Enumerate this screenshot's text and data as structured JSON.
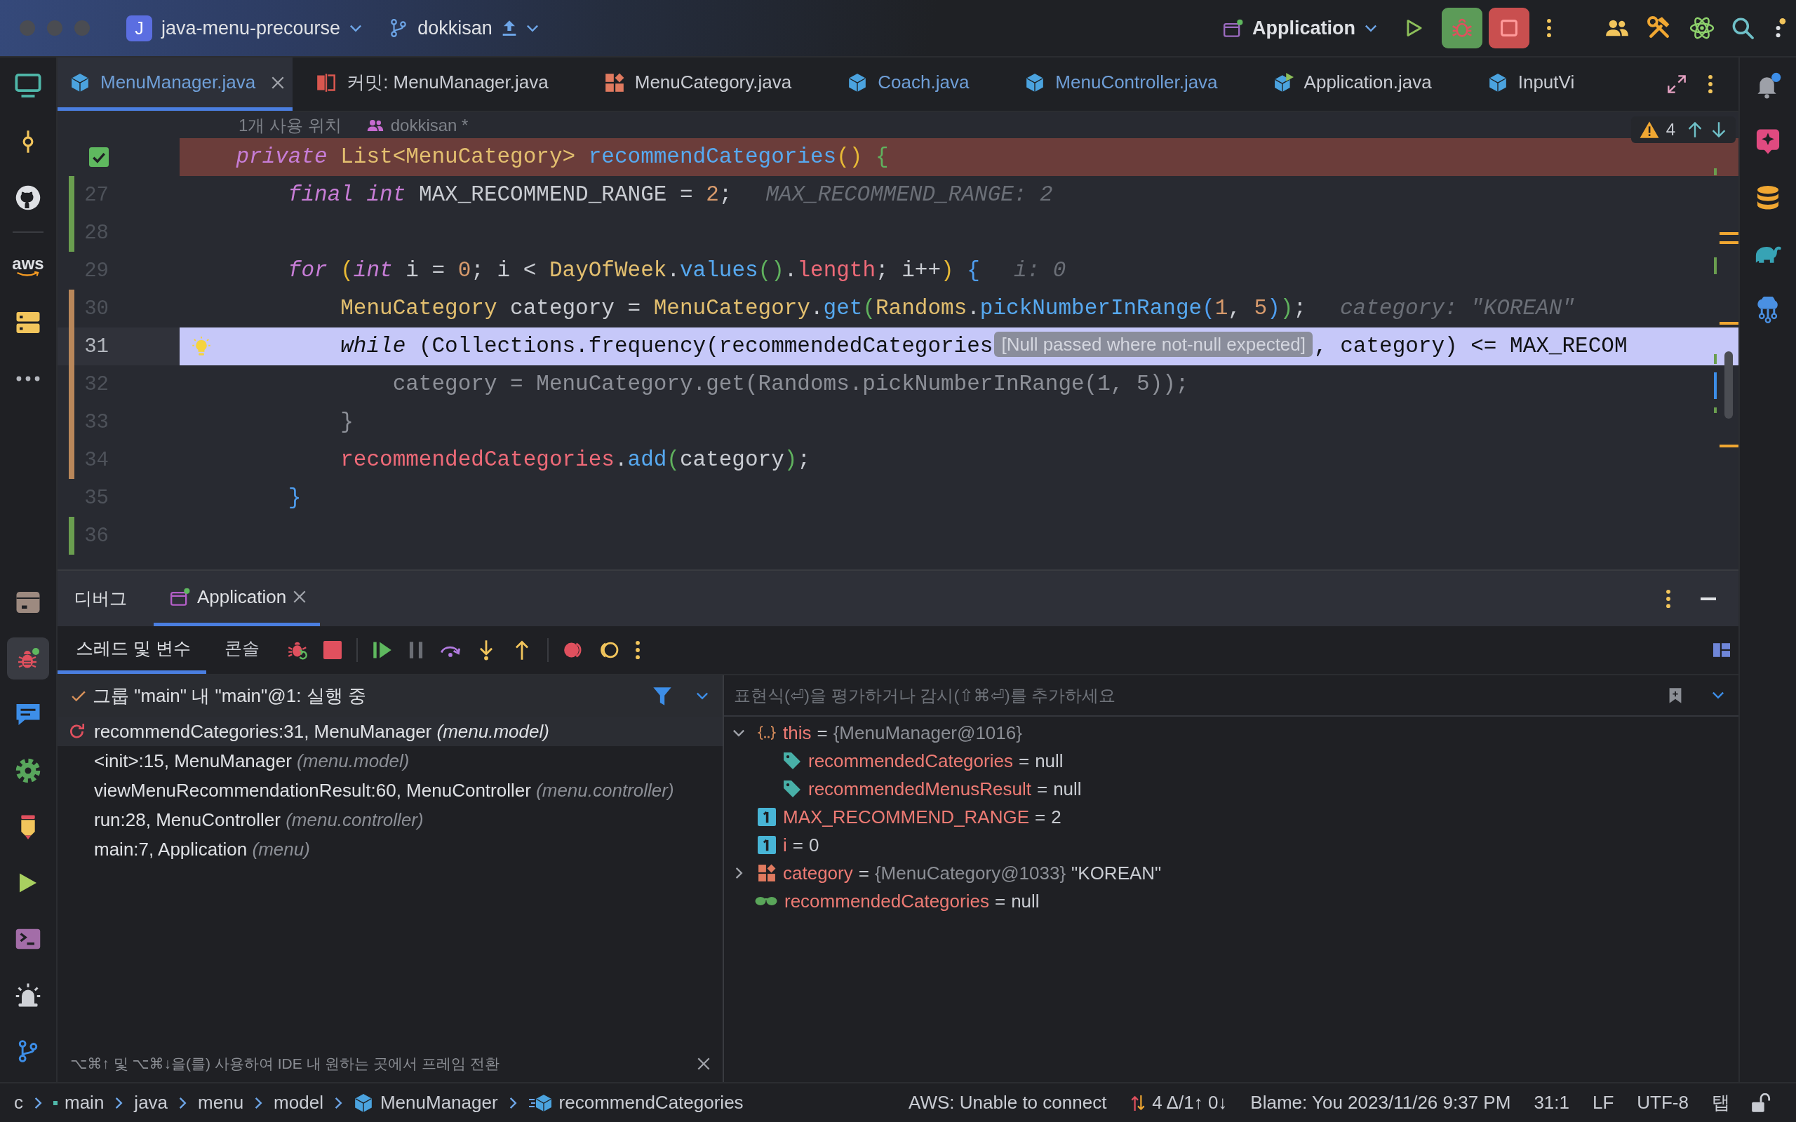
{
  "title_bar": {
    "project": {
      "badge": "J",
      "name": "java-menu-precourse"
    },
    "branch": "dokkisan",
    "run_config": "Application"
  },
  "left_toolbar": {
    "logo_text": "aws"
  },
  "editor_tabs": [
    {
      "label": "MenuManager.java",
      "kind": "class",
      "selected": true,
      "modified": true
    },
    {
      "label": "커밋: MenuManager.java",
      "kind": "diff",
      "selected": false,
      "modified": false
    },
    {
      "label": "MenuCategory.java",
      "kind": "enum",
      "selected": false,
      "modified": false
    },
    {
      "label": "Coach.java",
      "kind": "class",
      "selected": false,
      "modified": true
    },
    {
      "label": "MenuController.java",
      "kind": "class",
      "selected": false,
      "modified": true
    },
    {
      "label": "Application.java",
      "kind": "main_class",
      "selected": false,
      "modified": false
    },
    {
      "label": "InputVi",
      "kind": "class",
      "selected": false,
      "modified": false
    }
  ],
  "editor": {
    "usage_hint": "1개 사용 위치",
    "author_hint": "dokkisan *",
    "warning_count": "4",
    "lines": [
      {
        "breakpoint": true,
        "current": false,
        "added": false,
        "modified": false,
        "segments": [
          {
            "kind": "code",
            "tokens": [
              {
                "text": "    private ",
                "kind": "keyword"
              },
              {
                "text": "List<MenuCategory> ",
                "kind": "type"
              },
              {
                "text": "recommendCategories",
                "kind": "method"
              },
              {
                "text": "() ",
                "kind": "bracket1"
              },
              {
                "text": "{",
                "kind": "bracket2"
              }
            ]
          }
        ]
      },
      {
        "number": "27",
        "breakpoint": false,
        "current": false,
        "added": true,
        "modified": false,
        "segments": [
          {
            "kind": "code",
            "tokens": [
              {
                "text": "        final ",
                "kind": "keyword"
              },
              {
                "text": "int ",
                "kind": "keyword"
              },
              {
                "text": "MAX_RECOMMEND_RANGE = ",
                "kind": "plain"
              },
              {
                "text": "2",
                "kind": "number"
              },
              {
                "text": ";",
                "kind": "plain"
              }
            ]
          },
          {
            "kind": "value",
            "text": "MAX_RECOMMEND_RANGE: 2"
          }
        ]
      },
      {
        "number": "28",
        "breakpoint": false,
        "current": false,
        "added": true,
        "modified": false
      },
      {
        "number": "29",
        "breakpoint": false,
        "current": false,
        "added": false,
        "modified": false,
        "segments": [
          {
            "kind": "code",
            "tokens": [
              {
                "text": "        for ",
                "kind": "keyword"
              },
              {
                "text": "(",
                "kind": "bracket1"
              },
              {
                "text": "int ",
                "kind": "keyword"
              },
              {
                "text": "i = ",
                "kind": "plain"
              },
              {
                "text": "0",
                "kind": "number"
              },
              {
                "text": "; i < ",
                "kind": "plain"
              },
              {
                "text": "DayOfWeek",
                "kind": "type"
              },
              {
                "text": ".",
                "kind": "plain"
              },
              {
                "text": "values",
                "kind": "method"
              },
              {
                "text": "()",
                "kind": "bracket2"
              },
              {
                "text": ".",
                "kind": "plain"
              },
              {
                "text": "length",
                "kind": "field"
              },
              {
                "text": "; i++",
                "kind": "plain"
              },
              {
                "text": ") ",
                "kind": "bracket1"
              },
              {
                "text": "{",
                "kind": "bracket3"
              }
            ]
          },
          {
            "kind": "value",
            "text": "i: 0"
          }
        ]
      },
      {
        "number": "30",
        "breakpoint": false,
        "current": false,
        "added": false,
        "modified": true,
        "segments": [
          {
            "kind": "code",
            "tokens": [
              {
                "text": "            MenuCategory ",
                "kind": "type"
              },
              {
                "text": "category = ",
                "kind": "plain"
              },
              {
                "text": "MenuCategory",
                "kind": "type"
              },
              {
                "text": ".",
                "kind": "plain"
              },
              {
                "text": "get",
                "kind": "method"
              },
              {
                "text": "(",
                "kind": "bracket2"
              },
              {
                "text": "Randoms",
                "kind": "type"
              },
              {
                "text": ".",
                "kind": "plain"
              },
              {
                "text": "pickNumberInRange",
                "kind": "method"
              },
              {
                "text": "(",
                "kind": "bracket3"
              },
              {
                "text": "1",
                "kind": "number"
              },
              {
                "text": ", ",
                "kind": "plain"
              },
              {
                "text": "5",
                "kind": "number"
              },
              {
                "text": ")",
                "kind": "bracket3"
              },
              {
                "text": ")",
                "kind": "bracket2"
              },
              {
                "text": ";",
                "kind": "plain"
              }
            ]
          },
          {
            "kind": "value",
            "text": "category: \"KOREAN\""
          }
        ]
      },
      {
        "number": "31",
        "breakpoint": false,
        "current": true,
        "added": false,
        "modified": true,
        "segments": [
          {
            "kind": "code",
            "tokens": [
              {
                "text": "            while ",
                "kind": "keyword"
              },
              {
                "text": "(Collections.frequency(recommendedCategories",
                "kind": "plain"
              }
            ]
          },
          {
            "kind": "warning",
            "text": "[Null passed where not-null expected]"
          },
          {
            "kind": "code",
            "tokens": [
              {
                "text": ", category) <= MAX_RECOM",
                "kind": "plain"
              }
            ]
          }
        ]
      },
      {
        "number": "32",
        "breakpoint": false,
        "current": false,
        "added": false,
        "modified": true,
        "segments": [
          {
            "kind": "code",
            "tokens": [
              {
                "text": "                category = MenuCategory.get(Randoms.pickNumberInRange(1, 5));",
                "kind": "dim"
              }
            ]
          }
        ]
      },
      {
        "number": "33",
        "breakpoint": false,
        "current": false,
        "added": false,
        "modified": true,
        "segments": [
          {
            "kind": "code",
            "tokens": [
              {
                "text": "            }",
                "kind": "dim"
              }
            ]
          }
        ]
      },
      {
        "number": "34",
        "breakpoint": false,
        "current": false,
        "added": false,
        "modified": true,
        "segments": [
          {
            "kind": "code",
            "tokens": [
              {
                "text": "            recommendedCategories",
                "kind": "field"
              },
              {
                "text": ".",
                "kind": "plain"
              },
              {
                "text": "add",
                "kind": "method"
              },
              {
                "text": "(",
                "kind": "bracket2"
              },
              {
                "text": "category",
                "kind": "plain"
              },
              {
                "text": ")",
                "kind": "bracket2"
              },
              {
                "text": ";",
                "kind": "plain"
              }
            ]
          }
        ]
      },
      {
        "number": "35",
        "breakpoint": false,
        "current": false,
        "added": false,
        "modified": false,
        "segments": [
          {
            "kind": "code",
            "tokens": [
              {
                "text": "        }",
                "kind": "bracket3"
              }
            ]
          }
        ]
      },
      {
        "number": "36",
        "breakpoint": false,
        "current": false,
        "added": true,
        "modified": false
      }
    ]
  },
  "debug_panel": {
    "title": "디버그",
    "tabs": [
      {
        "label": "Application",
        "selected": true
      }
    ],
    "views": [
      {
        "label": "스레드 및 변수",
        "selected": true
      },
      {
        "label": "콘솔",
        "selected": false
      }
    ],
    "thread": "그룹 \"main\" 내 \"main\"@1: 실행 중",
    "frames": [
      {
        "text": "recommendCategories:31, MenuManager *(menu.model)*",
        "selected": true
      },
      {
        "text": "<init>:15, MenuManager *(menu.model)*",
        "selected": false
      },
      {
        "text": "viewMenuRecommendationResult:60, MenuController *(menu.controller)*",
        "selected": false
      },
      {
        "text": "run:28, MenuController *(menu.controller)*",
        "selected": false
      },
      {
        "text": "main:7, Application *(menu)*",
        "selected": false
      }
    ],
    "frames_hint": "⌥⌘↑ 및 ⌥⌘↓을(를) 사용하여 IDE 내 원하는 곳에서 프레임 전환",
    "evaluate": {
      "placeholder": "표현식(⏎)을 평가하거나 감시(⇧⌘⏎)를 추가하세요"
    },
    "variables": [
      {
        "kind": "object",
        "name": "this",
        "equals": "=",
        "ref": "{MenuManager@1016}",
        "expanded": true,
        "children": [
          {
            "kind": "field",
            "name": "recommendedCategories",
            "equals": "=",
            "value": "null"
          },
          {
            "kind": "field",
            "name": "recommendedMenusResult",
            "equals": "=",
            "value": "null"
          }
        ]
      },
      {
        "kind": "primitive",
        "name": "MAX_RECOMMEND_RANGE",
        "equals": "=",
        "value": "2"
      },
      {
        "kind": "primitive",
        "name": "i",
        "equals": "=",
        "value": "0"
      },
      {
        "kind": "enum",
        "name": "category",
        "equals": "=",
        "ref": "{MenuCategory@1033}",
        "value": "\"KOREAN\"",
        "expanded": false
      },
      {
        "kind": "watch",
        "name": "recommendedCategories",
        "equals": "=",
        "value": "null"
      }
    ]
  },
  "status_bar": {
    "breadcrumbs": [
      {
        "label": "c",
        "kind": "folder"
      },
      {
        "label": "main",
        "kind": "source_root"
      },
      {
        "label": "java",
        "kind": "folder"
      },
      {
        "label": "menu",
        "kind": "folder"
      },
      {
        "label": "model",
        "kind": "folder"
      },
      {
        "label": "MenuManager",
        "kind": "class"
      },
      {
        "label": "recommendCategories",
        "kind": "method"
      }
    ],
    "items": [
      {
        "label": "AWS: Unable to connect",
        "kind": "text"
      },
      {
        "label": "4 Δ/1↑ 0↓",
        "kind": "git"
      },
      {
        "label": "Blame: You 2023/11/26 9:37 PM",
        "kind": "text"
      },
      {
        "label": "31:1",
        "kind": "text"
      },
      {
        "label": "LF",
        "kind": "text"
      },
      {
        "label": "UTF-8",
        "kind": "text"
      },
      {
        "label": "탭",
        "kind": "text"
      }
    ]
  }
}
